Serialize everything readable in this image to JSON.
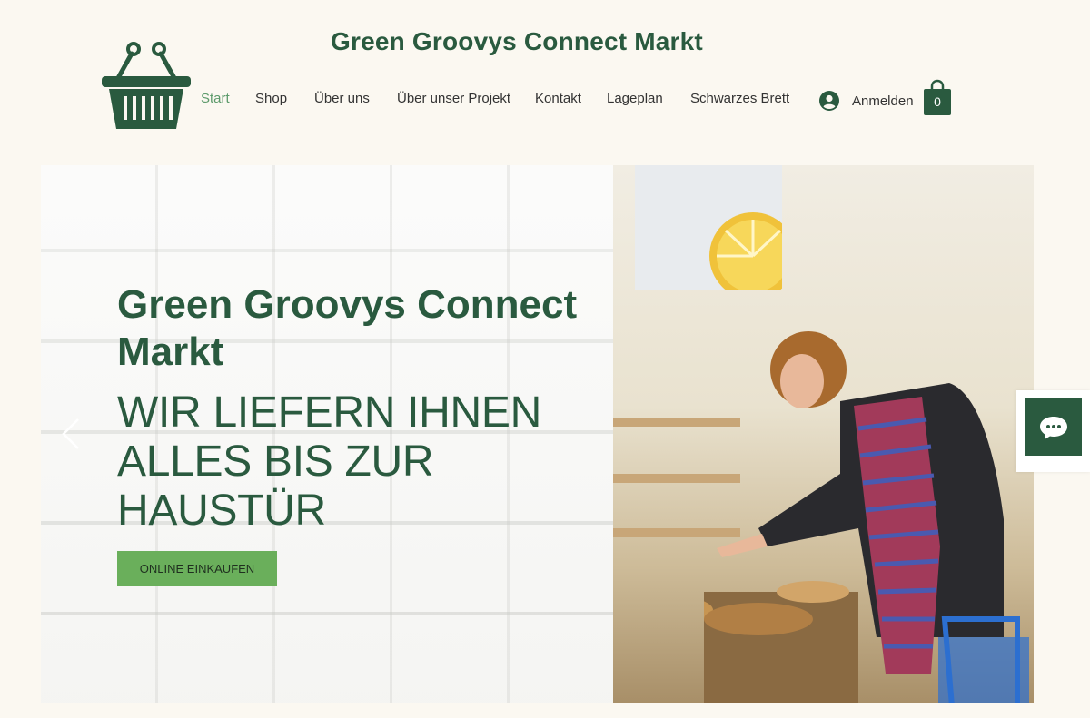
{
  "site": {
    "title": "Green Groovys Connect Markt"
  },
  "nav": {
    "items": [
      {
        "label": "Start",
        "active": true
      },
      {
        "label": "Shop"
      },
      {
        "label": "Über uns"
      },
      {
        "label": "Über unser Projekt"
      },
      {
        "label": "Kontakt"
      },
      {
        "label": "Lageplan"
      },
      {
        "label": "Schwarzes Brett"
      }
    ]
  },
  "account": {
    "login_label": "Anmelden",
    "icon": "user-icon"
  },
  "cart": {
    "count": "0",
    "icon": "shopping-bag-icon"
  },
  "hero": {
    "title": "Green Groovys Connect Markt",
    "subtitle": "WIR LIEFERN IHNEN ALLES BIS ZUR HAUSTÜR",
    "cta_label": "ONLINE EINKAUFEN"
  },
  "chat": {
    "icon": "chat-icon"
  },
  "colors": {
    "brand": "#2a5a3f",
    "accent": "#6aaf5b",
    "background": "#fbf8f1",
    "nav_active": "#5c9a6b"
  }
}
